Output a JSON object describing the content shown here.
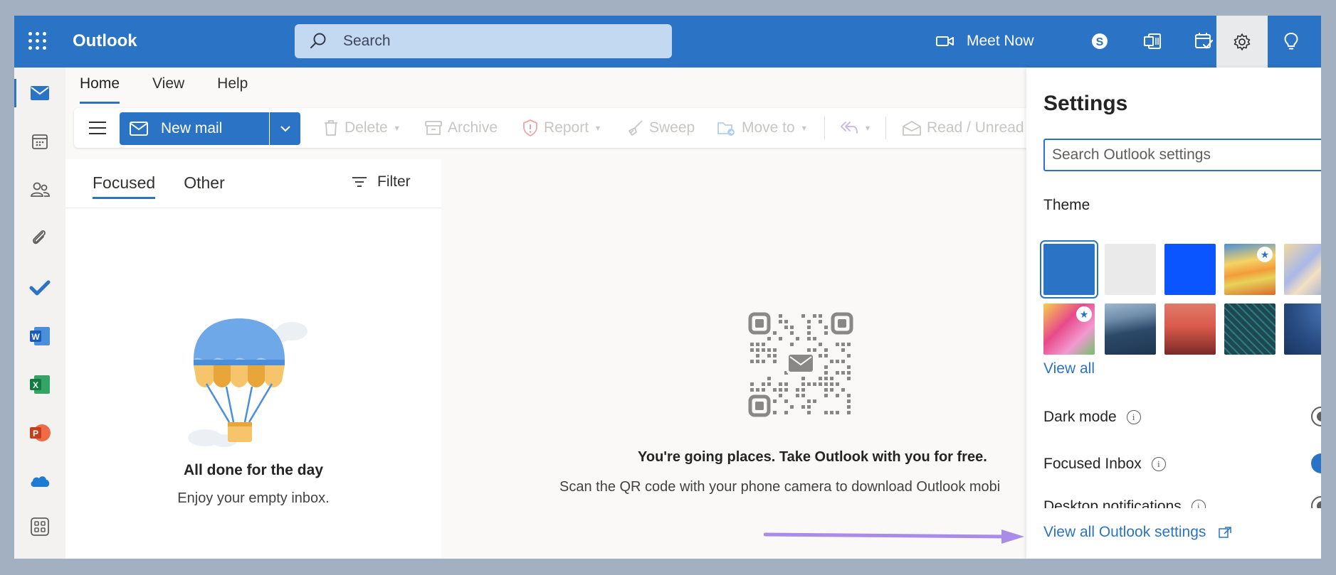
{
  "app": {
    "name": "Outlook"
  },
  "topbar": {
    "search_placeholder": "Search",
    "meet_now_label": "Meet Now"
  },
  "ribbon": {
    "tabs": [
      {
        "label": "Home",
        "active": true
      },
      {
        "label": "View",
        "active": false
      },
      {
        "label": "Help",
        "active": false
      }
    ],
    "new_mail_label": "New mail",
    "delete_label": "Delete",
    "archive_label": "Archive",
    "report_label": "Report",
    "sweep_label": "Sweep",
    "move_to_label": "Move to",
    "read_unread_label": "Read / Unread"
  },
  "mail_list": {
    "tabs": [
      {
        "label": "Focused",
        "active": true
      },
      {
        "label": "Other",
        "active": false
      }
    ],
    "filter_label": "Filter",
    "empty_title": "All done for the day",
    "empty_subtitle": "Enjoy your empty inbox."
  },
  "reading_pane": {
    "promo_title": "You're going places. Take Outlook with you for free.",
    "promo_subtitle": "Scan the QR code with your phone camera to download Outlook mobi"
  },
  "settings": {
    "title": "Settings",
    "search_placeholder": "Search Outlook settings",
    "theme_label": "Theme",
    "view_all_label": "View all",
    "dark_mode_label": "Dark mode",
    "dark_mode_on": false,
    "focused_inbox_label": "Focused Inbox",
    "focused_inbox_on": true,
    "desktop_notifications_label": "Desktop notifications",
    "view_all_settings_label": "View all Outlook settings"
  },
  "colors": {
    "brand_blue": "#2b73c4",
    "annotation_arrow": "#a98be8"
  }
}
